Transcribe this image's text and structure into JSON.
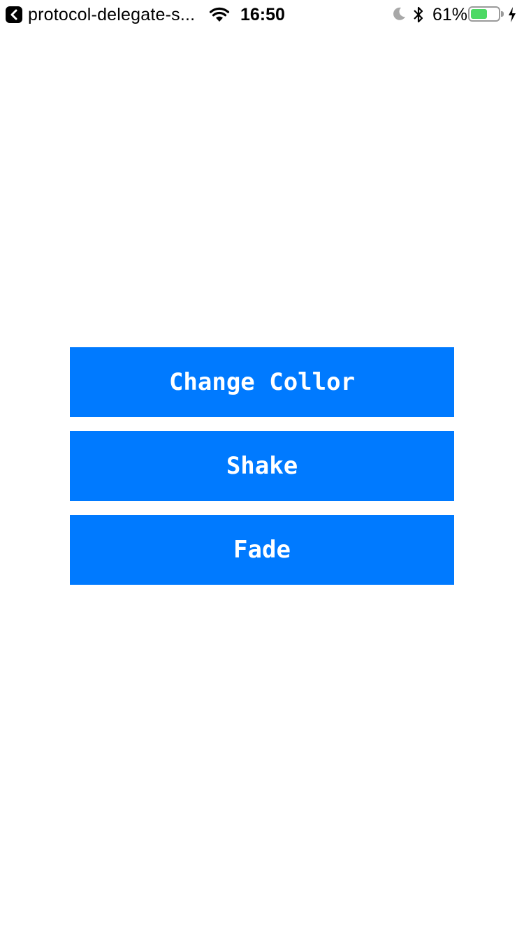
{
  "status_bar": {
    "back_app_name": "protocol-delegate-s...",
    "time": "16:50",
    "battery_percent": "61%",
    "battery_level": 0.61,
    "icons": [
      "back-chevron-icon",
      "wifi-icon",
      "moon-icon",
      "bluetooth-icon",
      "battery-icon",
      "charging-bolt-icon"
    ]
  },
  "colors": {
    "button_background": "#007aff",
    "button_text": "#ffffff",
    "battery_fill": "#4cd964"
  },
  "buttons": {
    "change_color": "Change Collor",
    "shake": "Shake",
    "fade": "Fade"
  }
}
